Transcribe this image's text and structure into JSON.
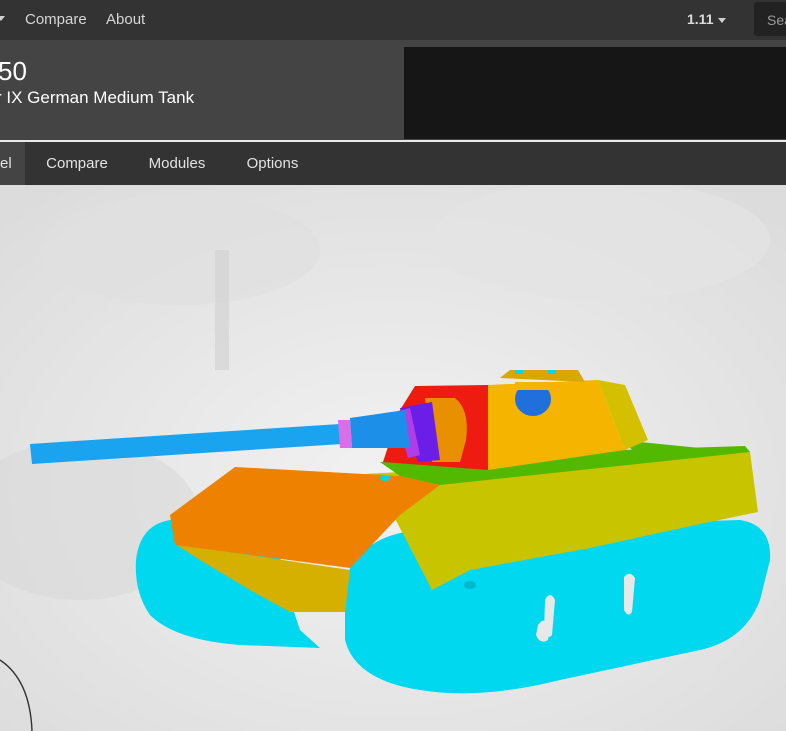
{
  "nav": {
    "links": [
      "Compare",
      "About"
    ],
    "version": "1.11",
    "search_placeholder": "Sea"
  },
  "tank": {
    "name_visible": "50",
    "subtitle_visible": "r IX German Medium Tank"
  },
  "tabs": [
    "el",
    "Compare",
    "Modules",
    "Options"
  ],
  "active_tab": 0,
  "viewer": {
    "mode": "armor-model",
    "colors": {
      "tracks": "#00d8f0",
      "hull_front": "#ee8200",
      "hull_side": "#c9c400",
      "turret": "#f4b400",
      "mantlet": "#ee1c10",
      "gun": "#1aa3ee",
      "deck": "#52b800"
    }
  }
}
